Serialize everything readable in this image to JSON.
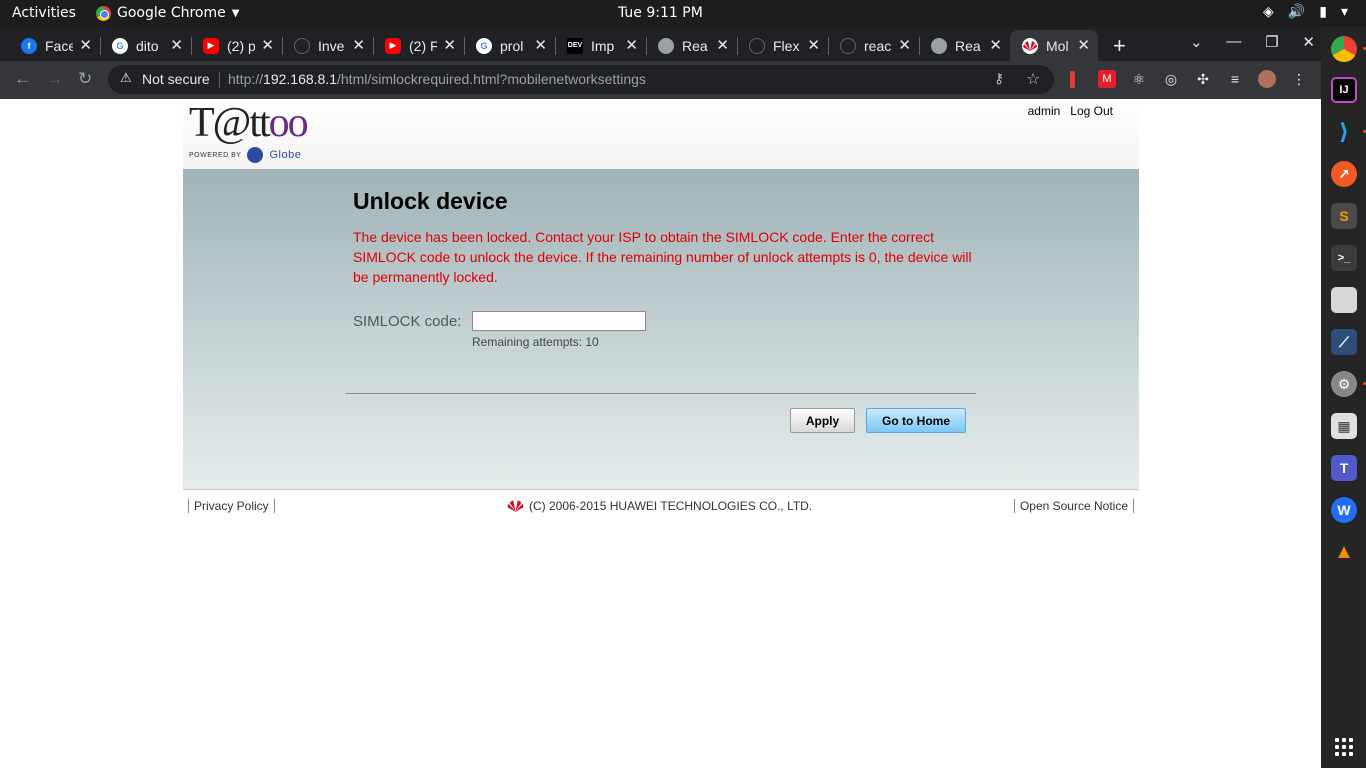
{
  "topbar": {
    "activities": "Activities",
    "app_name": "Google Chrome",
    "clock": "Tue  9:11 PM"
  },
  "tabs": [
    {
      "title": "Face",
      "icon": "facebook-icon",
      "color": "#1877f2"
    },
    {
      "title": "dito",
      "icon": "google-icon",
      "color": "#ffffff"
    },
    {
      "title": "(2) p",
      "icon": "youtube-icon",
      "color": "#ff0000"
    },
    {
      "title": "Inve",
      "icon": "hexagon-icon",
      "color": "#5f6368"
    },
    {
      "title": "(2) F",
      "icon": "youtube-icon",
      "color": "#ff0000"
    },
    {
      "title": "prol",
      "icon": "google-icon",
      "color": "#ffffff"
    },
    {
      "title": "Imp",
      "icon": "dev-icon",
      "color": "#000000"
    },
    {
      "title": "Rea",
      "icon": "globe-icon",
      "color": "#9aa0a6"
    },
    {
      "title": "Flex",
      "icon": "hexagon-icon",
      "color": "#5f6368"
    },
    {
      "title": "reac",
      "icon": "github-icon",
      "color": "#202124"
    },
    {
      "title": "Rea",
      "icon": "globe-icon",
      "color": "#9aa0a6"
    },
    {
      "title": "Mol",
      "icon": "huawei-icon",
      "color": "#cf0a2c",
      "active": true
    }
  ],
  "omnibox": {
    "security": "Not secure",
    "url_prefix": "http://",
    "url_host": "192.168.8.1",
    "url_path": "/html/simlockrequired.html?mobilenetworksettings"
  },
  "header": {
    "logo_text_t": "T@tt",
    "logo_text_oo": "oo",
    "powered_by": "POWERED BY",
    "globe": "Globe",
    "admin": "admin",
    "logout": "Log Out"
  },
  "unlock": {
    "title": "Unlock device",
    "message": "The device has been locked. Contact your ISP to obtain the SIMLOCK code. Enter the correct SIMLOCK code to unlock the device. If the remaining number of unlock attempts is 0, the device will be permanently locked.",
    "code_label": "SIMLOCK code:",
    "code_value": "",
    "attempts_label": "Remaining attempts:  10",
    "apply": "Apply",
    "go_home": "Go to Home"
  },
  "footer": {
    "privacy": "Privacy Policy",
    "copyright": "(C) 2006-2015 HUAWEI TECHNOLOGIES CO., LTD.",
    "open_source": "Open Source Notice"
  },
  "colors": {
    "warning_text": "#e00000",
    "home_button": "#7cc7f5",
    "content_gradient_top": "#9fb3b8"
  }
}
